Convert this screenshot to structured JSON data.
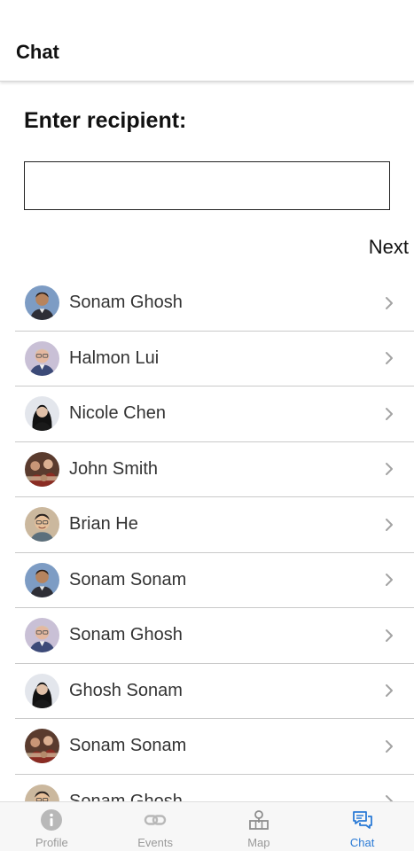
{
  "header": {
    "title": "Chat"
  },
  "form": {
    "prompt": "Enter recipient:",
    "recipient_value": "",
    "next_label": "Next"
  },
  "contacts": [
    {
      "name": "Sonam Ghosh",
      "avatar": "man-blue-bg-avatar"
    },
    {
      "name": "Halmon Lui",
      "avatar": "man-glasses-avatar"
    },
    {
      "name": "Nicole Chen",
      "avatar": "woman-dark-hair-avatar"
    },
    {
      "name": "John Smith",
      "avatar": "group-photo-avatar"
    },
    {
      "name": "Brian He",
      "avatar": "man-smiling-avatar"
    },
    {
      "name": "Sonam Sonam",
      "avatar": "man-blue-bg-avatar"
    },
    {
      "name": "Sonam Ghosh",
      "avatar": "man-glasses-avatar"
    },
    {
      "name": "Ghosh Sonam",
      "avatar": "woman-dark-hair-avatar"
    },
    {
      "name": "Sonam Sonam",
      "avatar": "group-photo-avatar"
    },
    {
      "name": "Sonam Ghosh",
      "avatar": "man-smiling-avatar"
    }
  ],
  "tabs": [
    {
      "label": "Profile",
      "icon": "info-icon"
    },
    {
      "label": "Events",
      "icon": "link-icon"
    },
    {
      "label": "Map",
      "icon": "map-icon"
    },
    {
      "label": "Chat",
      "icon": "chat-icon"
    }
  ],
  "active_tab": "Chat",
  "colors": {
    "accent": "#2b7bd6",
    "inactive": "#9a9a9a",
    "divider": "#c9c9c9"
  }
}
